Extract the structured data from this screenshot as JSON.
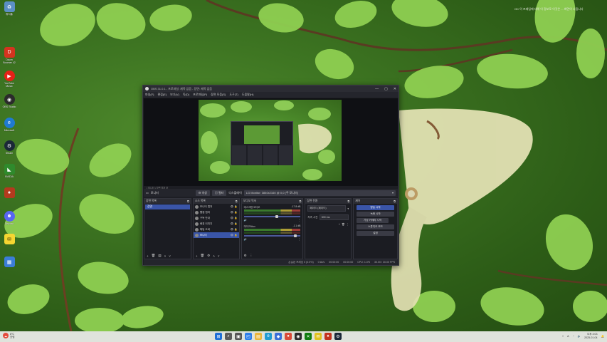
{
  "desktop": {
    "icons": [
      {
        "label": "휴지통",
        "icon": "recycle-bin-icon",
        "color": "#5b8fc4"
      },
      {
        "label": "Daum\nBoomer 42",
        "icon": "app-icon",
        "color": "#d4341f"
      },
      {
        "label": "YouTube\nMusic",
        "icon": "youtube-music-icon",
        "color": "#e62117"
      },
      {
        "label": "OBS Studio",
        "icon": "obs-icon",
        "color": "#2b2b2b"
      },
      {
        "label": "Microsoft",
        "icon": "edge-icon",
        "color": "#1f7ad1"
      },
      {
        "label": "Steam",
        "icon": "steam-icon",
        "color": "#1b2838"
      },
      {
        "label": "NVIDIA",
        "icon": "nvidia-icon",
        "color": "#2f8a2c"
      },
      {
        "label": "",
        "icon": "game-icon",
        "color": "#b33a1e"
      },
      {
        "label": "Discord",
        "icon": "discord-icon",
        "color": "#5865f2"
      },
      {
        "label": "",
        "icon": "kakaotalk-icon",
        "color": "#f5d631"
      },
      {
        "label": "",
        "icon": "chart-app-icon",
        "color": "#3b7dd8"
      }
    ],
    "notification": "OC 이 프레임에 대해 이 정보로 이것은 ... 화면이 나옴니다"
  },
  "obs": {
    "title": "OBS 31.0.1 - 프로파일: 제목 없음 - 장면: 제목 없음",
    "title_ctrls": [
      "—",
      "▢",
      "✕"
    ],
    "menu": [
      "파일(F)",
      "편집(E)",
      "보기(V)",
      "독(D)",
      "프로파일(P)",
      "장면 모음(S)",
      "도구(T)",
      "도움말(H)"
    ],
    "preview_label": "▪ 모니터  ▪ 장면 캡처 포",
    "context_bar": {
      "source_name": "모니터",
      "properties": "속성",
      "filters": "필터",
      "display_label": "디스플레이",
      "display_value": "LG Monitor: 3840x2160 @ 0,0 (주 모니터)"
    },
    "scenes": {
      "header": "장면 목록",
      "items": [
        "장면"
      ]
    },
    "sources": {
      "header": "소스 목록",
      "items": [
        {
          "name": "모니터 캡처",
          "selected": false
        },
        {
          "name": "웹캠 캡처",
          "selected": false
        },
        {
          "name": "구독 안내",
          "selected": false
        },
        {
          "name": "배경 이미지",
          "selected": false
        },
        {
          "name": "채팅 오버",
          "selected": false
        },
        {
          "name": "모니터",
          "selected": true
        }
      ]
    },
    "mixer": {
      "header": "오디오 믹서",
      "channels": [
        {
          "name": "데스크탑 오디오",
          "db": "-17.8 dB",
          "level": 0.62
        },
        {
          "name": "마이크/Aux",
          "db": "-1.1 dB",
          "level": 0.55
        }
      ]
    },
    "transitions": {
      "header": "장면 전환",
      "type": "페이드 (페이드)",
      "duration_label": "지속 시간",
      "duration_value": "300 ms"
    },
    "controls": {
      "header": "제어",
      "buttons": [
        "방송 시작",
        "녹화 시작",
        "가상 카메라 시작",
        "스튜디오 모드",
        "설정"
      ]
    },
    "status": {
      "dropped": "손실된 프레임 0 (0.0%)",
      "bitrate": "0 kb/s",
      "stream_time": "00:00:00",
      "rec_time": "00:00:00",
      "cpu": "CPU: 1.0%",
      "fps": "30.00 / 30.00 FPS"
    }
  },
  "taskbar": {
    "weather_temp": "8°C",
    "weather_text": "흐림",
    "apps": [
      {
        "icon": "start-icon",
        "color": "#1e6fd6",
        "glyph": "⊞"
      },
      {
        "icon": "search-icon",
        "color": "#444",
        "glyph": "⌕"
      },
      {
        "icon": "task-view-icon",
        "color": "#555",
        "glyph": "▣"
      },
      {
        "icon": "widgets-icon",
        "color": "#2b7de9",
        "glyph": "◰"
      },
      {
        "icon": "explorer-icon",
        "color": "#e9b53a",
        "glyph": "▤"
      },
      {
        "icon": "edge-icon",
        "color": "#1f9bd1",
        "glyph": "e"
      },
      {
        "icon": "store-icon",
        "color": "#3a6fd8",
        "glyph": "◆"
      },
      {
        "icon": "chrome-icon",
        "color": "#d94a38",
        "glyph": "●"
      },
      {
        "icon": "obs-icon",
        "color": "#2b2b2b",
        "glyph": "◉"
      },
      {
        "icon": "xbox-icon",
        "color": "#107c10",
        "glyph": "✕"
      },
      {
        "icon": "kakaotalk-icon",
        "color": "#e0c21f",
        "glyph": "✉"
      },
      {
        "icon": "game-icon",
        "color": "#c2331e",
        "glyph": "♠"
      },
      {
        "icon": "steam-icon",
        "color": "#1b2838",
        "glyph": "⚙"
      }
    ],
    "tray": {
      "language": "A",
      "time": "오후 4:03",
      "date": "2025-01-04"
    }
  }
}
